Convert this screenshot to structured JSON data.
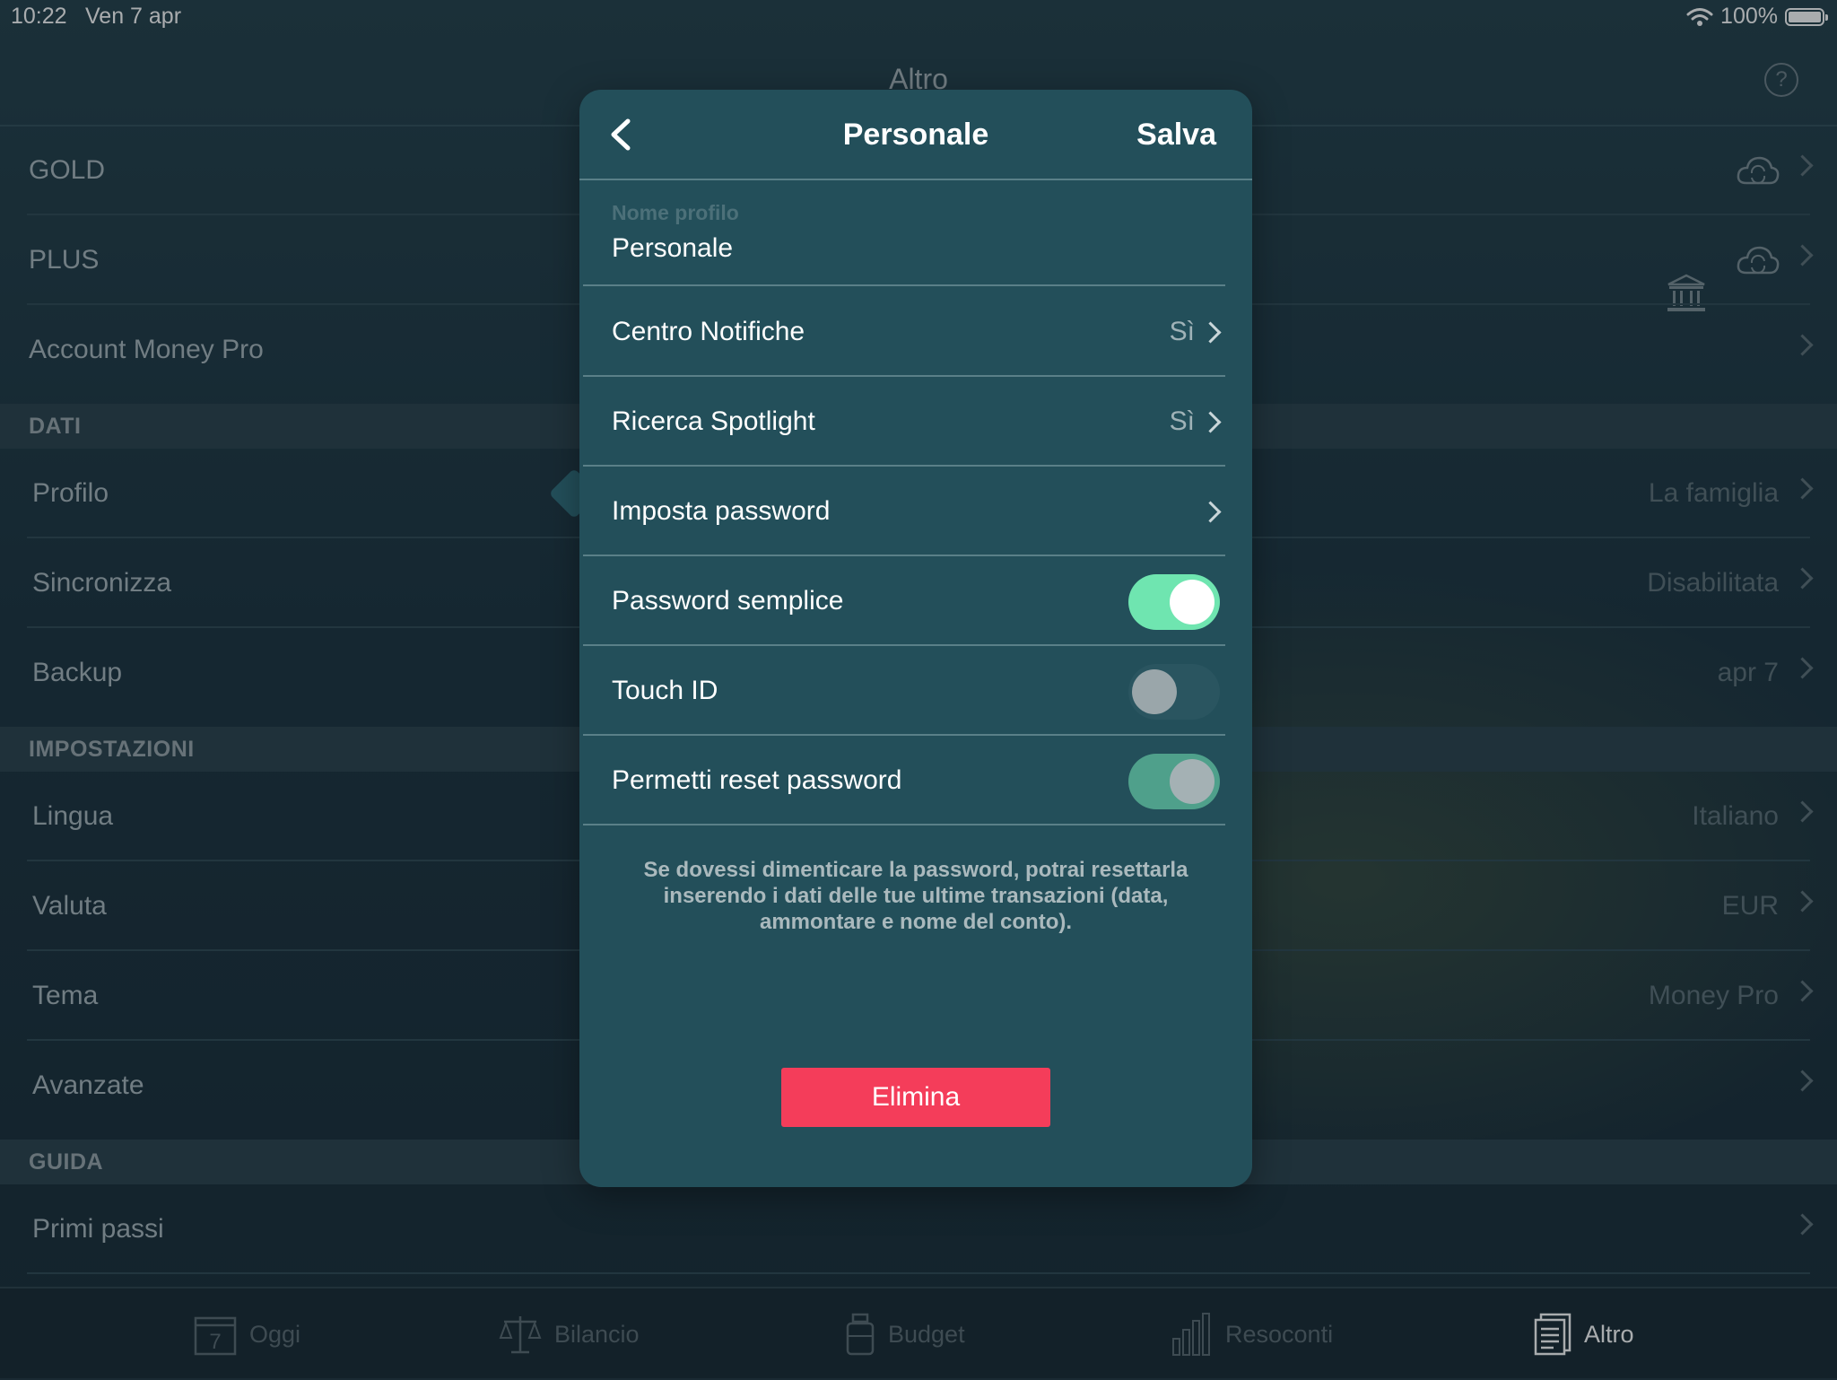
{
  "status": {
    "time": "10:22",
    "date": "Ven 7 apr",
    "battery": "100%"
  },
  "nav": {
    "title": "Altro",
    "help": "?"
  },
  "list": {
    "gold": "GOLD",
    "plus": "PLUS",
    "account": "Account Money Pro",
    "sections": {
      "dati": "DATI",
      "impostazioni": "IMPOSTAZIONI",
      "guida": "GUIDA"
    },
    "profilo": {
      "label": "Profilo",
      "value": "La famiglia"
    },
    "sincronizza": {
      "label": "Sincronizza",
      "value": "Disabilitata"
    },
    "backup": {
      "label": "Backup",
      "value": "apr 7"
    },
    "lingua": {
      "label": "Lingua",
      "value": "Italiano"
    },
    "valuta": {
      "label": "Valuta",
      "value": "EUR"
    },
    "tema": {
      "label": "Tema",
      "value": "Money Pro"
    },
    "avanzate": {
      "label": "Avanzate"
    },
    "primi_passi": {
      "label": "Primi passi"
    }
  },
  "tabs": {
    "oggi": "Oggi",
    "oggi_day": "7",
    "bilancio": "Bilancio",
    "budget": "Budget",
    "resoconti": "Resoconti",
    "altro": "Altro"
  },
  "popover": {
    "title": "Personale",
    "save": "Salva",
    "profile_name_label": "Nome profilo",
    "profile_name_value": "Personale",
    "centro_notifiche": {
      "label": "Centro Notifiche",
      "value": "Sì"
    },
    "ricerca_spotlight": {
      "label": "Ricerca Spotlight",
      "value": "Sì"
    },
    "imposta_password": {
      "label": "Imposta password"
    },
    "password_semplice": {
      "label": "Password semplice",
      "on": true
    },
    "touch_id": {
      "label": "Touch ID",
      "on": false
    },
    "permetti_reset": {
      "label": "Permetti reset password",
      "on": true
    },
    "note": "Se dovessi dimenticare la password, potrai resettarla inserendo i dati delle tue ultime transazioni (data, ammontare e nome del conto).",
    "delete": "Elimina"
  },
  "colors": {
    "accent_toggle": "#6fe5b0",
    "delete": "#f43d5a",
    "popover_bg": "#234f5a"
  }
}
